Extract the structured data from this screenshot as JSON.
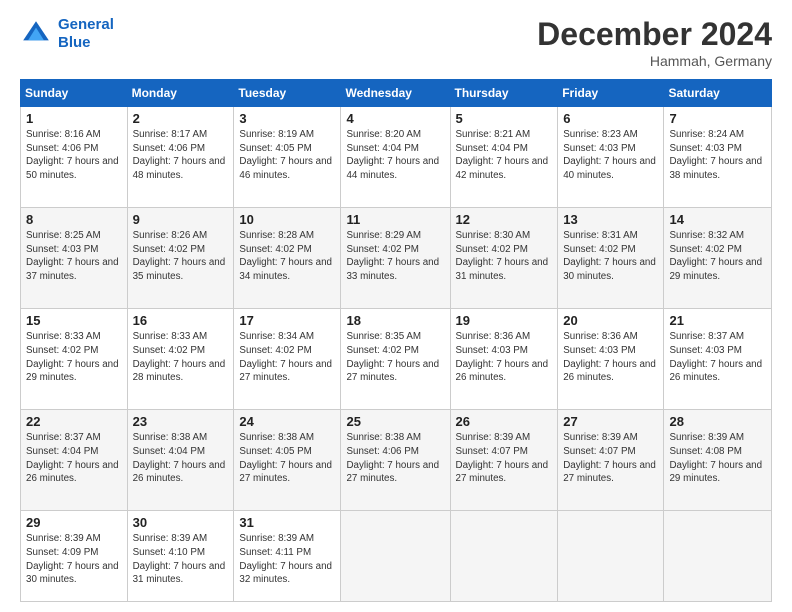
{
  "header": {
    "logo_line1": "General",
    "logo_line2": "Blue",
    "month": "December 2024",
    "location": "Hammah, Germany"
  },
  "days_of_week": [
    "Sunday",
    "Monday",
    "Tuesday",
    "Wednesday",
    "Thursday",
    "Friday",
    "Saturday"
  ],
  "weeks": [
    [
      {
        "day": "1",
        "sunrise": "8:16 AM",
        "sunset": "4:06 PM",
        "daylight": "7 hours and 50 minutes."
      },
      {
        "day": "2",
        "sunrise": "8:17 AM",
        "sunset": "4:06 PM",
        "daylight": "7 hours and 48 minutes."
      },
      {
        "day": "3",
        "sunrise": "8:19 AM",
        "sunset": "4:05 PM",
        "daylight": "7 hours and 46 minutes."
      },
      {
        "day": "4",
        "sunrise": "8:20 AM",
        "sunset": "4:04 PM",
        "daylight": "7 hours and 44 minutes."
      },
      {
        "day": "5",
        "sunrise": "8:21 AM",
        "sunset": "4:04 PM",
        "daylight": "7 hours and 42 minutes."
      },
      {
        "day": "6",
        "sunrise": "8:23 AM",
        "sunset": "4:03 PM",
        "daylight": "7 hours and 40 minutes."
      },
      {
        "day": "7",
        "sunrise": "8:24 AM",
        "sunset": "4:03 PM",
        "daylight": "7 hours and 38 minutes."
      }
    ],
    [
      {
        "day": "8",
        "sunrise": "8:25 AM",
        "sunset": "4:03 PM",
        "daylight": "7 hours and 37 minutes."
      },
      {
        "day": "9",
        "sunrise": "8:26 AM",
        "sunset": "4:02 PM",
        "daylight": "7 hours and 35 minutes."
      },
      {
        "day": "10",
        "sunrise": "8:28 AM",
        "sunset": "4:02 PM",
        "daylight": "7 hours and 34 minutes."
      },
      {
        "day": "11",
        "sunrise": "8:29 AM",
        "sunset": "4:02 PM",
        "daylight": "7 hours and 33 minutes."
      },
      {
        "day": "12",
        "sunrise": "8:30 AM",
        "sunset": "4:02 PM",
        "daylight": "7 hours and 31 minutes."
      },
      {
        "day": "13",
        "sunrise": "8:31 AM",
        "sunset": "4:02 PM",
        "daylight": "7 hours and 30 minutes."
      },
      {
        "day": "14",
        "sunrise": "8:32 AM",
        "sunset": "4:02 PM",
        "daylight": "7 hours and 29 minutes."
      }
    ],
    [
      {
        "day": "15",
        "sunrise": "8:33 AM",
        "sunset": "4:02 PM",
        "daylight": "7 hours and 29 minutes."
      },
      {
        "day": "16",
        "sunrise": "8:33 AM",
        "sunset": "4:02 PM",
        "daylight": "7 hours and 28 minutes."
      },
      {
        "day": "17",
        "sunrise": "8:34 AM",
        "sunset": "4:02 PM",
        "daylight": "7 hours and 27 minutes."
      },
      {
        "day": "18",
        "sunrise": "8:35 AM",
        "sunset": "4:02 PM",
        "daylight": "7 hours and 27 minutes."
      },
      {
        "day": "19",
        "sunrise": "8:36 AM",
        "sunset": "4:03 PM",
        "daylight": "7 hours and 26 minutes."
      },
      {
        "day": "20",
        "sunrise": "8:36 AM",
        "sunset": "4:03 PM",
        "daylight": "7 hours and 26 minutes."
      },
      {
        "day": "21",
        "sunrise": "8:37 AM",
        "sunset": "4:03 PM",
        "daylight": "7 hours and 26 minutes."
      }
    ],
    [
      {
        "day": "22",
        "sunrise": "8:37 AM",
        "sunset": "4:04 PM",
        "daylight": "7 hours and 26 minutes."
      },
      {
        "day": "23",
        "sunrise": "8:38 AM",
        "sunset": "4:04 PM",
        "daylight": "7 hours and 26 minutes."
      },
      {
        "day": "24",
        "sunrise": "8:38 AM",
        "sunset": "4:05 PM",
        "daylight": "7 hours and 27 minutes."
      },
      {
        "day": "25",
        "sunrise": "8:38 AM",
        "sunset": "4:06 PM",
        "daylight": "7 hours and 27 minutes."
      },
      {
        "day": "26",
        "sunrise": "8:39 AM",
        "sunset": "4:07 PM",
        "daylight": "7 hours and 27 minutes."
      },
      {
        "day": "27",
        "sunrise": "8:39 AM",
        "sunset": "4:07 PM",
        "daylight": "7 hours and 27 minutes."
      },
      {
        "day": "28",
        "sunrise": "8:39 AM",
        "sunset": "4:08 PM",
        "daylight": "7 hours and 29 minutes."
      }
    ],
    [
      {
        "day": "29",
        "sunrise": "8:39 AM",
        "sunset": "4:09 PM",
        "daylight": "7 hours and 30 minutes."
      },
      {
        "day": "30",
        "sunrise": "8:39 AM",
        "sunset": "4:10 PM",
        "daylight": "7 hours and 31 minutes."
      },
      {
        "day": "31",
        "sunrise": "8:39 AM",
        "sunset": "4:11 PM",
        "daylight": "7 hours and 32 minutes."
      },
      null,
      null,
      null,
      null
    ]
  ]
}
